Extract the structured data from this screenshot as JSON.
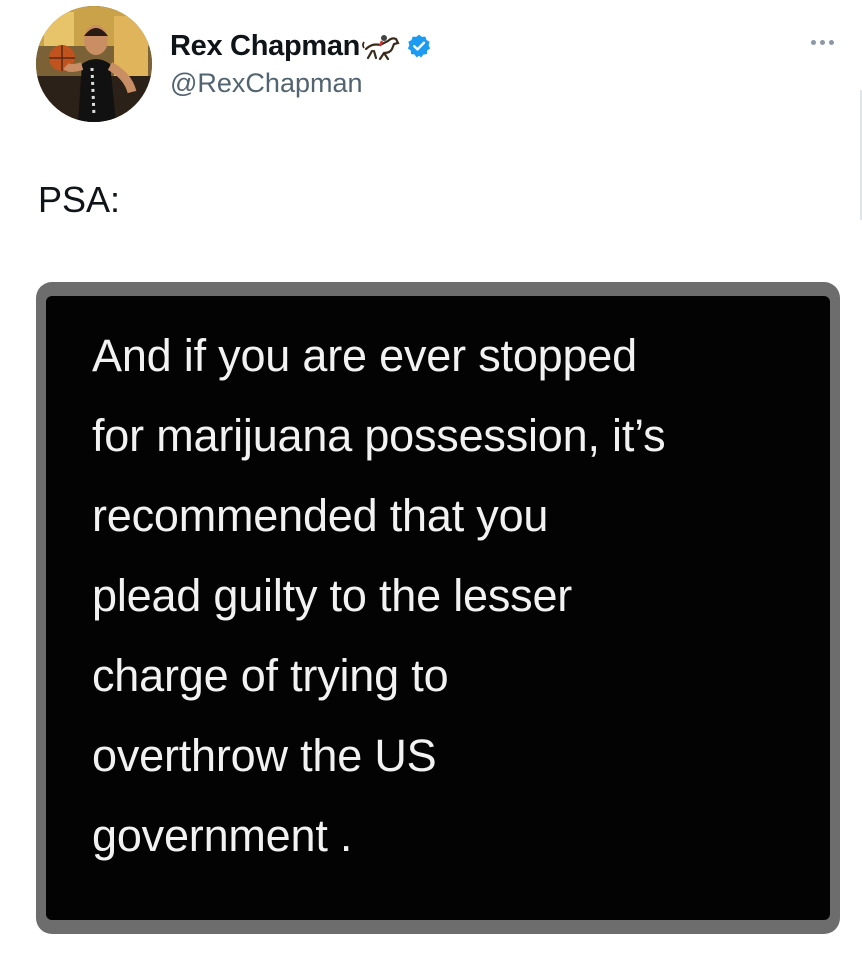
{
  "author": {
    "display_name": "Rex Chapman",
    "handle": "@RexChapman",
    "avatar_icon": "basketball-player-avatar",
    "name_emoji_icon": "horse-racing-icon",
    "verified_icon": "verified-badge-icon",
    "verified_color": "#1d9bf0"
  },
  "menu": {
    "icon": "more-options-icon"
  },
  "tweet": {
    "text": "PSA:"
  },
  "media": {
    "background_color": "#030303",
    "frame_color": "#6d6d6d",
    "lines": [
      "And if you are ever stopped",
      "for marijuana possession, it’s",
      "recommended that you",
      "plead guilty to the lesser",
      "charge of trying to",
      "overthrow the US",
      "government ."
    ]
  }
}
